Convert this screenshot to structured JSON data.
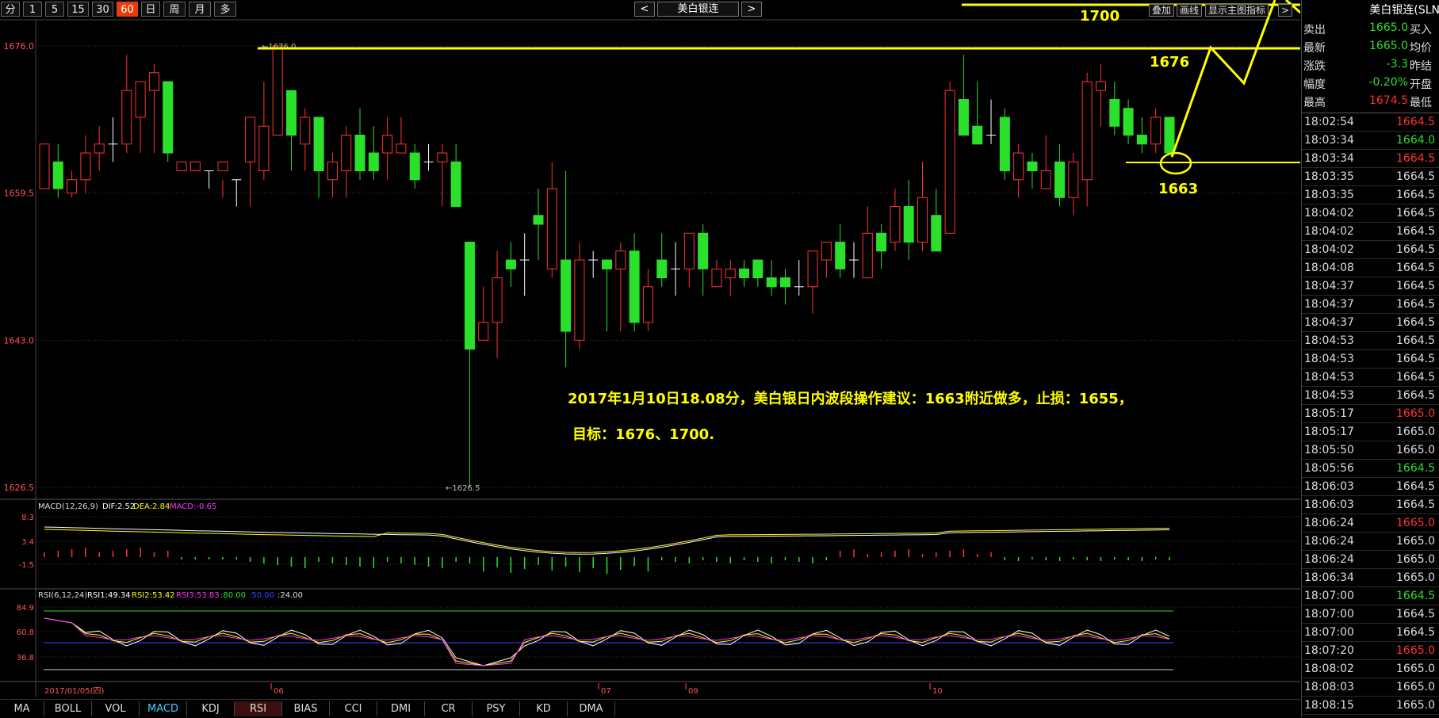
{
  "toolbar": {
    "periods": [
      {
        "label": "分",
        "active": false
      },
      {
        "label": "1",
        "active": false
      },
      {
        "label": "5",
        "active": false
      },
      {
        "label": "15",
        "active": false
      },
      {
        "label": "30",
        "active": false
      },
      {
        "label": "60",
        "active": true
      },
      {
        "label": "日",
        "active": false
      },
      {
        "label": "周",
        "active": false
      },
      {
        "label": "月",
        "active": false
      },
      {
        "label": "多",
        "active": false
      }
    ],
    "prev": "<",
    "instrument": "美白银连",
    "next": ">",
    "right_tools": [
      "叠加",
      "画线",
      "显示主图指标",
      "<",
      ">"
    ]
  },
  "chart": {
    "y_ticks": [
      "1676.0",
      "1659.5",
      "1643.0",
      "1626.5"
    ],
    "high_marker": "1676.0",
    "low_marker": "1626.5",
    "date_labels": [
      "2017/01/05(四)",
      "06",
      "07",
      "09",
      "10"
    ],
    "macd_label": "MACD(12,26,9)",
    "macd_dif": "DIF:2.52",
    "macd_dea": "DEA:2.84",
    "macd_val": "MACD:-0.65",
    "macd_ticks": [
      "8.3",
      "3.4",
      "-1.5"
    ],
    "rsi_label": "RSI(6,12,24)",
    "rsi1": "RSI1:49.34",
    "rsi2": "RSI2:53.42",
    "rsi3": "RSI3:53.83",
    "rsi_l80": ":80.00",
    "rsi_l50": ":50.00",
    "rsi_l24": ":24.00",
    "rsi_ticks": [
      "84.9",
      "60.8",
      "36.8"
    ]
  },
  "annotations": {
    "level_1700": "1700",
    "level_1676": "1676",
    "level_1663": "1663",
    "note_line1": "2017年1月10日18.08分，美白银日内波段操作建议：1663附近做多，止损：1655，",
    "note_line2": "目标：1676、1700."
  },
  "indicator_tabs": [
    {
      "label": "MA"
    },
    {
      "label": "BOLL"
    },
    {
      "label": "VOL"
    },
    {
      "label": "MACD",
      "active": true
    },
    {
      "label": "KDJ"
    },
    {
      "label": "RSI",
      "hl": true
    },
    {
      "label": "BIAS"
    },
    {
      "label": "CCI"
    },
    {
      "label": "DMI"
    },
    {
      "label": "CR"
    },
    {
      "label": "PSY"
    },
    {
      "label": "KD"
    },
    {
      "label": "DMA"
    }
  ],
  "quote": {
    "title": "美白银连(SLN",
    "rows": [
      {
        "label": "卖出",
        "value": "1665.0",
        "color": "dn",
        "label2": "买入"
      },
      {
        "label": "最新",
        "value": "1665.0",
        "color": "dn",
        "label2": "均价"
      },
      {
        "label": "涨跌",
        "value": "-3.3",
        "color": "dn",
        "label2": "昨结"
      },
      {
        "label": "幅度",
        "value": "-0.20%",
        "color": "dn",
        "label2": "开盘"
      },
      {
        "label": "最高",
        "value": "1674.5",
        "color": "up",
        "label2": "最低"
      }
    ],
    "ticks": [
      {
        "time": "18:02:54",
        "price": "1664.5",
        "color": "up"
      },
      {
        "time": "18:03:34",
        "price": "1664.0",
        "color": "dn"
      },
      {
        "time": "18:03:34",
        "price": "1664.5",
        "color": "up"
      },
      {
        "time": "18:03:35",
        "price": "1664.5",
        "color": "wh"
      },
      {
        "time": "18:03:35",
        "price": "1664.5",
        "color": "wh"
      },
      {
        "time": "18:04:02",
        "price": "1664.5",
        "color": "wh"
      },
      {
        "time": "18:04:02",
        "price": "1664.5",
        "color": "wh"
      },
      {
        "time": "18:04:02",
        "price": "1664.5",
        "color": "wh"
      },
      {
        "time": "18:04:08",
        "price": "1664.5",
        "color": "wh"
      },
      {
        "time": "18:04:37",
        "price": "1664.5",
        "color": "wh"
      },
      {
        "time": "18:04:37",
        "price": "1664.5",
        "color": "wh"
      },
      {
        "time": "18:04:37",
        "price": "1664.5",
        "color": "wh"
      },
      {
        "time": "18:04:53",
        "price": "1664.5",
        "color": "wh"
      },
      {
        "time": "18:04:53",
        "price": "1664.5",
        "color": "wh"
      },
      {
        "time": "18:04:53",
        "price": "1664.5",
        "color": "wh"
      },
      {
        "time": "18:04:53",
        "price": "1664.5",
        "color": "wh"
      },
      {
        "time": "18:05:17",
        "price": "1665.0",
        "color": "up"
      },
      {
        "time": "18:05:17",
        "price": "1665.0",
        "color": "wh"
      },
      {
        "time": "18:05:50",
        "price": "1665.0",
        "color": "wh"
      },
      {
        "time": "18:05:56",
        "price": "1664.5",
        "color": "dn"
      },
      {
        "time": "18:06:03",
        "price": "1664.5",
        "color": "wh"
      },
      {
        "time": "18:06:03",
        "price": "1664.5",
        "color": "wh"
      },
      {
        "time": "18:06:24",
        "price": "1665.0",
        "color": "up"
      },
      {
        "time": "18:06:24",
        "price": "1665.0",
        "color": "wh"
      },
      {
        "time": "18:06:24",
        "price": "1665.0",
        "color": "wh"
      },
      {
        "time": "18:06:34",
        "price": "1665.0",
        "color": "wh"
      },
      {
        "time": "18:07:00",
        "price": "1664.5",
        "color": "dn"
      },
      {
        "time": "18:07:00",
        "price": "1664.5",
        "color": "wh"
      },
      {
        "time": "18:07:00",
        "price": "1664.5",
        "color": "wh"
      },
      {
        "time": "18:07:20",
        "price": "1665.0",
        "color": "up"
      },
      {
        "time": "18:08:02",
        "price": "1665.0",
        "color": "wh"
      },
      {
        "time": "18:08:03",
        "price": "1665.0",
        "color": "wh"
      },
      {
        "time": "18:08:15",
        "price": "1665.0",
        "color": "wh"
      }
    ]
  },
  "colors": {
    "up": "#ff3333",
    "down": "#2be02b",
    "annotation": "#ffff00",
    "active_period": "#e83b0b"
  },
  "chart_data": {
    "type": "candlestick",
    "y_range": [
      1626.5,
      1676.0
    ],
    "candles": [
      [
        1660,
        1665,
        1660.5,
        1660.5
      ],
      [
        1663,
        1660,
        1665,
        1659
      ],
      [
        1659.5,
        1661,
        1659,
        1662
      ],
      [
        1661,
        1664,
        1659.5,
        1666
      ],
      [
        1664,
        1665,
        1662,
        1667
      ],
      [
        1665,
        1665,
        1663,
        1668
      ],
      [
        1665,
        1671,
        1664,
        1675
      ],
      [
        1668,
        1672,
        1664,
        1670
      ],
      [
        1671,
        1673,
        1664,
        1674
      ],
      [
        1672,
        1664,
        1663,
        1670
      ],
      [
        1662,
        1663,
        1661,
        1661
      ],
      [
        1662,
        1663,
        1660,
        1660
      ],
      [
        1662,
        1662,
        1660,
        1662
      ],
      [
        1662,
        1663,
        1659,
        1661
      ],
      [
        1661,
        1661,
        1658,
        1661
      ],
      [
        1663,
        1668,
        1658,
        1668
      ],
      [
        1662,
        1667,
        1661,
        1672
      ],
      [
        1666,
        1676,
        1666,
        1676
      ],
      [
        1671,
        1666,
        1662,
        1670
      ],
      [
        1665,
        1668,
        1662,
        1669
      ],
      [
        1668,
        1662,
        1659,
        1668
      ],
      [
        1661,
        1663,
        1659,
        1664
      ],
      [
        1662,
        1666,
        1659,
        1667
      ],
      [
        1666,
        1662,
        1661,
        1669
      ],
      [
        1664,
        1662,
        1661,
        1667
      ],
      [
        1664,
        1666,
        1661,
        1668
      ],
      [
        1664,
        1665,
        1664,
        1668
      ],
      [
        1664,
        1661,
        1660,
        1665
      ],
      [
        1663,
        1663,
        1662,
        1665
      ],
      [
        1663,
        1664,
        1658,
        1665
      ],
      [
        1663,
        1658,
        1658,
        1665
      ],
      [
        1654,
        1642,
        1626.5,
        1654
      ],
      [
        1643,
        1645,
        1643,
        1649
      ],
      [
        1645,
        1650,
        1641,
        1653
      ],
      [
        1652,
        1651,
        1649,
        1654
      ],
      [
        1652,
        1652,
        1648,
        1655
      ],
      [
        1657,
        1656,
        1652,
        1660
      ],
      [
        1651,
        1660,
        1650,
        1663
      ],
      [
        1652,
        1644,
        1640,
        1662
      ],
      [
        1643,
        1652,
        1642,
        1654
      ],
      [
        1652,
        1652,
        1650,
        1653
      ],
      [
        1652,
        1651,
        1644,
        1652
      ],
      [
        1651,
        1653,
        1644,
        1654
      ],
      [
        1653,
        1645,
        1644,
        1655
      ],
      [
        1645,
        1649,
        1644,
        1651
      ],
      [
        1652,
        1650,
        1649,
        1655
      ],
      [
        1651,
        1651,
        1648,
        1654
      ],
      [
        1651,
        1655,
        1649,
        1655
      ],
      [
        1655,
        1651,
        1648,
        1656
      ],
      [
        1649,
        1651,
        1650,
        1652
      ],
      [
        1650,
        1651,
        1648,
        1652
      ],
      [
        1651,
        1650,
        1649,
        1652
      ],
      [
        1652,
        1650,
        1649,
        1652
      ],
      [
        1650,
        1649,
        1648,
        1652
      ],
      [
        1650,
        1649,
        1647,
        1651
      ],
      [
        1649,
        1649,
        1648,
        1652
      ],
      [
        1649,
        1653,
        1646,
        1653
      ],
      [
        1652,
        1654,
        1650,
        1654
      ],
      [
        1654,
        1651,
        1650,
        1656
      ],
      [
        1652,
        1652,
        1650,
        1654
      ],
      [
        1650,
        1655,
        1650,
        1658
      ],
      [
        1655,
        1653,
        1651,
        1656
      ],
      [
        1654,
        1658,
        1653,
        1660
      ],
      [
        1658,
        1654,
        1652,
        1661
      ],
      [
        1654,
        1659,
        1653,
        1663
      ],
      [
        1657,
        1653,
        1653,
        1660
      ],
      [
        1655,
        1671,
        1659,
        1672
      ],
      [
        1670,
        1666,
        1667,
        1675
      ],
      [
        1667,
        1665,
        1665,
        1672
      ],
      [
        1666,
        1666,
        1665,
        1670
      ],
      [
        1668,
        1662,
        1661,
        1669
      ],
      [
        1661,
        1664,
        1659,
        1665
      ],
      [
        1663,
        1662,
        1660,
        1664
      ],
      [
        1660,
        1662,
        1660,
        1666
      ],
      [
        1663,
        1659,
        1658,
        1665
      ],
      [
        1659,
        1663,
        1657,
        1664
      ],
      [
        1661,
        1672,
        1658,
        1673
      ],
      [
        1671,
        1672,
        1667,
        1674
      ],
      [
        1670,
        1667,
        1666,
        1672
      ],
      [
        1669,
        1666,
        1665,
        1670
      ],
      [
        1666,
        1665,
        1664,
        1668
      ],
      [
        1665,
        1668,
        1664,
        1669
      ],
      [
        1668,
        1664,
        1664,
        1668
      ]
    ]
  }
}
